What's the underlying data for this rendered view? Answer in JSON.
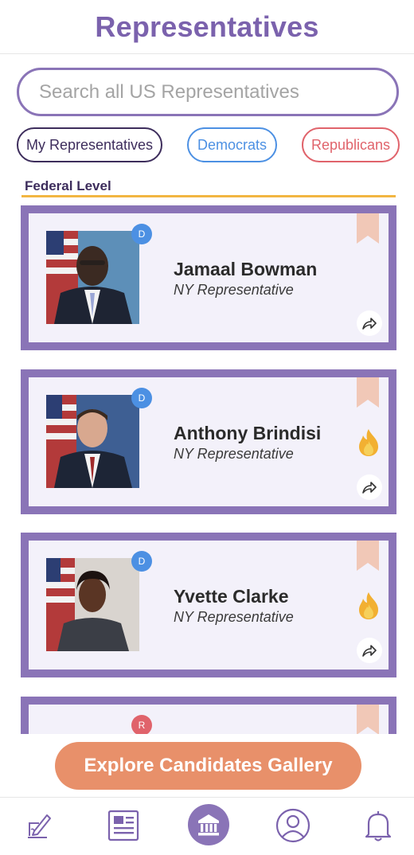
{
  "header": {
    "title": "Representatives"
  },
  "search": {
    "placeholder": "Search all US Representatives"
  },
  "filters": {
    "mine": "My Representatives",
    "democrats": "Democrats",
    "republicans": "Republicans"
  },
  "section": {
    "label": "Federal Level"
  },
  "cards": [
    {
      "name": "Jamaal Bowman",
      "role": "NY Representative",
      "party": "D",
      "icon": "bookmark-icon",
      "trending": false
    },
    {
      "name": "Anthony Brindisi",
      "role": "NY Representative",
      "party": "D",
      "icon": "bookmark-icon",
      "trending": true
    },
    {
      "name": "Yvette Clarke",
      "role": "NY Representative",
      "party": "D",
      "icon": "bookmark-icon",
      "trending": true
    },
    {
      "name": "",
      "role": "",
      "party": "R",
      "icon": "bookmark-icon",
      "trending": false
    }
  ],
  "cta": {
    "label": "Explore Candidates Gallery"
  },
  "tabs": [
    "compose-icon",
    "newspaper-icon",
    "capitol-icon",
    "profile-icon",
    "bell-icon"
  ],
  "colors": {
    "brand": "#7b62ad",
    "cardBorder": "#8a74b7",
    "democrat": "#4c90e3",
    "republican": "#e0636b",
    "accent": "#f2b642",
    "cta": "#e8906a"
  }
}
